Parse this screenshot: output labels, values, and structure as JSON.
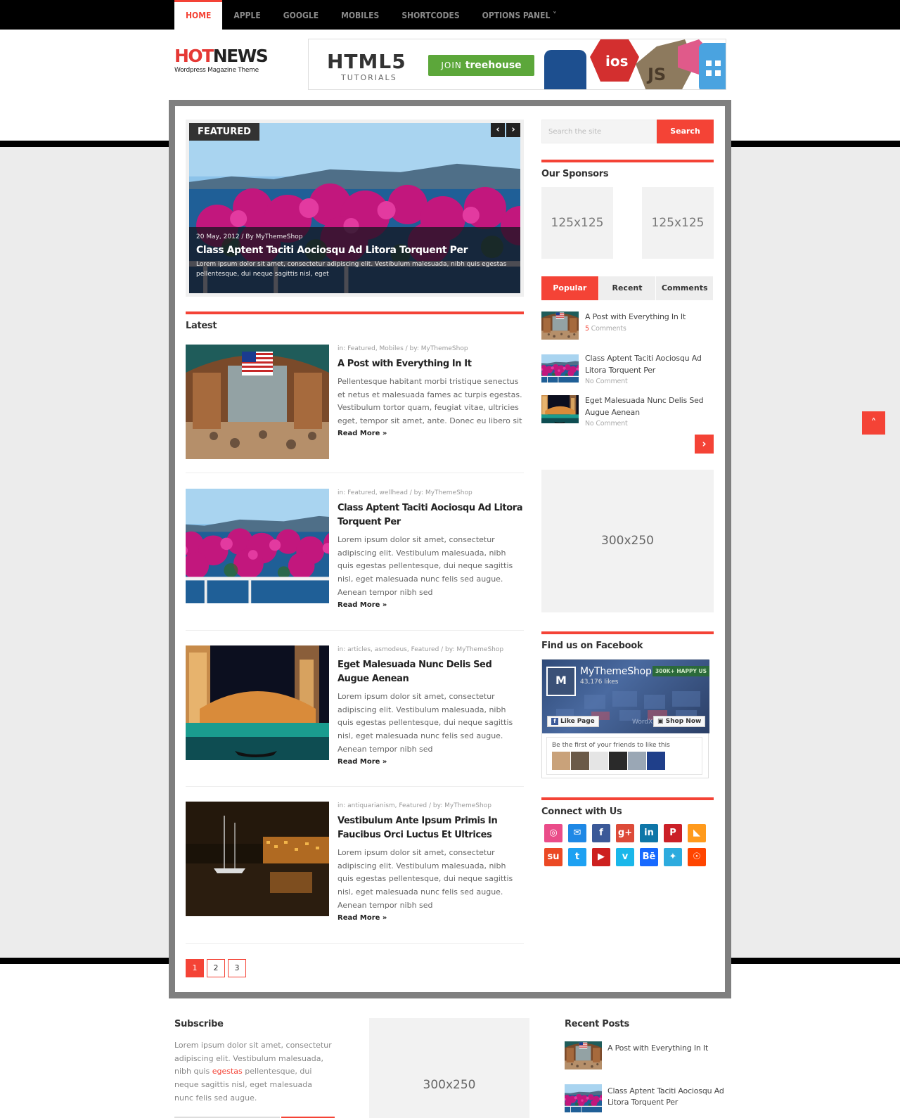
{
  "nav": {
    "items": [
      "HOME",
      "APPLE",
      "GOOGLE",
      "MOBILES",
      "SHORTCODES",
      "OPTIONS PANEL ˅"
    ]
  },
  "logo": {
    "part1": "HOT",
    "part2": "NEWS",
    "tagline": "Wordpress Magazine Theme"
  },
  "banner": {
    "title": "HTML5",
    "subtitle": "TUTORIALS",
    "cta_1": "JOIN",
    "cta_2": "treehouse",
    "badge_1": "ios",
    "badge_2": "JS"
  },
  "featured": {
    "badge": "FEATURED",
    "prev_label": "‹",
    "next_label": "›",
    "meta": "20 May, 2012 / By MyThemeShop",
    "title": "Class Aptent Taciti Aociosqu Ad Litora Torquent Per",
    "excerpt": "Lorem ipsum dolor sit amet, consectetur adipiscing elit. Vestibulum malesuada, nibh quis egestas pellentesque, dui neque sagittis nisl, eget"
  },
  "latest": {
    "heading": "Latest",
    "read_more": "Read More »",
    "posts": [
      {
        "meta": "in: Featured, Mobiles / by: MyThemeShop",
        "title": "A Post with Everything In It",
        "excerpt": "Pellentesque habitant morbi tristique senectus et netus et malesuada fames ac turpis egestas. Vestibulum tortor quam, feugiat vitae, ultricies eget, tempor sit amet, ante. Donec eu libero sit"
      },
      {
        "meta": "in: Featured, wellhead / by: MyThemeShop",
        "title": "Class Aptent Taciti Aociosqu Ad Litora Torquent Per",
        "excerpt": "Lorem ipsum dolor sit amet, consectetur adipiscing elit. Vestibulum malesuada, nibh quis egestas pellentesque, dui neque sagittis nisl, eget malesuada nunc felis sed augue. Aenean tempor nibh sed"
      },
      {
        "meta": "in: articles, asmodeus, Featured / by: MyThemeShop",
        "title": "Eget Malesuada Nunc Delis Sed Augue Aenean",
        "excerpt": "Lorem ipsum dolor sit amet, consectetur adipiscing elit. Vestibulum malesuada, nibh quis egestas pellentesque, dui neque sagittis nisl, eget malesuada nunc felis sed augue. Aenean tempor nibh sed"
      },
      {
        "meta": "in: antiquarianism, Featured / by: MyThemeShop",
        "title": "Vestibulum Ante Ipsum Primis In Faucibus Orci Luctus Et Ultrices",
        "excerpt": "Lorem ipsum dolor sit amet, consectetur adipiscing elit. Vestibulum malesuada, nibh quis egestas pellentesque, dui neque sagittis nisl, eget malesuada nunc felis sed augue. Aenean tempor nibh sed"
      }
    ]
  },
  "pagination": [
    "1",
    "2",
    "3"
  ],
  "sidebar": {
    "search_placeholder": "Search the site",
    "search_button": "Search",
    "sponsors_heading": "Our Sponsors",
    "sponsor_1": "125x125",
    "sponsor_2": "125x125",
    "tabs": [
      "Popular",
      "Recent",
      "Comments"
    ],
    "popular": [
      {
        "title": "A Post with Everything In It",
        "count": "5",
        "comments": " Comments"
      },
      {
        "title": "Class Aptent Taciti Aociosqu Ad Litora Torquent Per",
        "comments": "No Comment"
      },
      {
        "title": "Eget Malesuada Nunc Delis Sed Augue Aenean",
        "comments": "No Comment"
      }
    ],
    "next_label": "›",
    "ad_label": "300x250",
    "facebook_heading": "Find us on Facebook",
    "fb_name": "MyThemeShop",
    "fb_likes": "43,176 likes",
    "fb_happy": "300K+ HAPPY US",
    "fb_like_btn": "Like Page",
    "fb_shop_btn": "Shop Now",
    "fb_cover_text": "WordX",
    "fb_friends_text": "Be the first of your friends to like this",
    "connect_heading": "Connect with Us",
    "social": [
      {
        "name": "dribbble-icon",
        "glyph": "◎",
        "color": "#ea4c89"
      },
      {
        "name": "email-icon",
        "glyph": "✉",
        "color": "#1e88e5"
      },
      {
        "name": "facebook-icon",
        "glyph": "f",
        "color": "#3b5998"
      },
      {
        "name": "google-plus-icon",
        "glyph": "g+",
        "color": "#dd4b39"
      },
      {
        "name": "linkedin-icon",
        "glyph": "in",
        "color": "#0e76a8"
      },
      {
        "name": "pinterest-icon",
        "glyph": "P",
        "color": "#cb2027"
      },
      {
        "name": "rss-icon",
        "glyph": "◣",
        "color": "#ff9a1c"
      },
      {
        "name": "stumbleupon-icon",
        "glyph": "su",
        "color": "#eb4924"
      },
      {
        "name": "twitter-icon",
        "glyph": "t",
        "color": "#1da1f2"
      },
      {
        "name": "youtube-icon",
        "glyph": "▶",
        "color": "#cd201f"
      },
      {
        "name": "vimeo-icon",
        "glyph": "v",
        "color": "#1ab7ea"
      },
      {
        "name": "behance-icon",
        "glyph": "Bē",
        "color": "#1769ff"
      },
      {
        "name": "delicious-icon",
        "glyph": "✦",
        "color": "#2dabde"
      },
      {
        "name": "reddit-icon",
        "glyph": "☉",
        "color": "#ff4500"
      }
    ]
  },
  "scroll_top_label": "˄",
  "footer": {
    "subscribe_heading": "Subscribe",
    "subscribe_text_1": "Lorem ipsum dolor sit amet, consectetur adipiscing elit. Vestibulum malesuada, nibh quis ",
    "subscribe_link": "egestas",
    "subscribe_text_2": " pellentesque, dui neque sagittis nisl, eget malesuada nunc felis sed augue.",
    "ad_label": "300x250",
    "recent_heading": "Recent Posts",
    "recent": [
      "A Post with Everything In It",
      "Class Aptent Taciti Aociosqu Ad Litora Torquent Per"
    ]
  },
  "colors": {
    "accent": "#f44336",
    "dark": "#000000",
    "frame": "#7f7f7f",
    "panel_bg": "#ececec"
  }
}
